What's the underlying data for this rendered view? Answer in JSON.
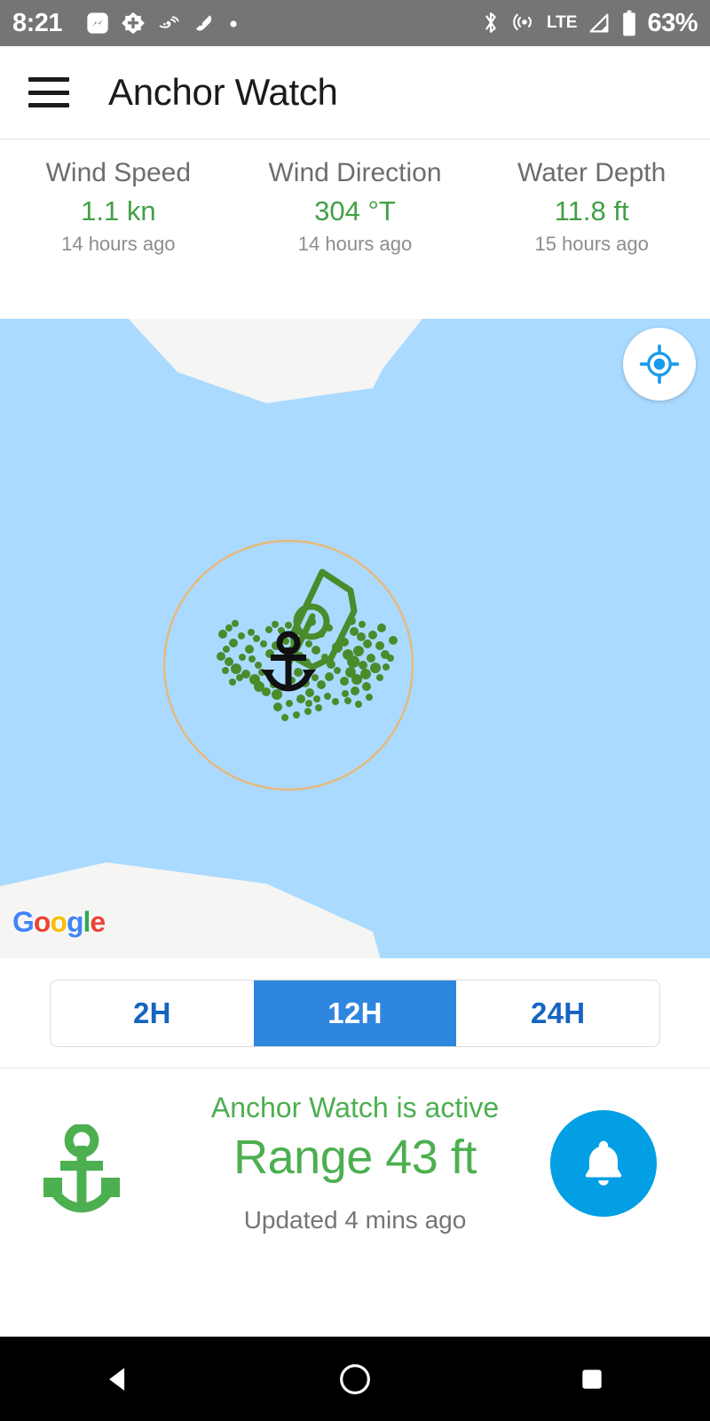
{
  "status_bar": {
    "time": "8:21",
    "battery_percent": "63%",
    "network_type": "LTE",
    "notification_icons": [
      "messenger-icon",
      "plus-badge-icon",
      "bird-icon",
      "shape-icon",
      "dot-icon"
    ],
    "system_icons": [
      "bluetooth-icon",
      "hotspot-icon",
      "signal-icon",
      "battery-icon"
    ]
  },
  "app_bar": {
    "menu_icon": "hamburger-menu-icon",
    "title": "Anchor Watch"
  },
  "stats": [
    {
      "label": "Wind Speed",
      "value": "1.1 kn",
      "time": "14 hours ago"
    },
    {
      "label": "Wind Direction",
      "value": "304 °T",
      "time": "14 hours ago"
    },
    {
      "label": "Water Depth",
      "value": "11.8 ft",
      "time": "15 hours ago"
    }
  ],
  "map": {
    "my_location_icon": "my-location-crosshair-icon",
    "attribution": "Google",
    "attribution_letters": [
      "G",
      "o",
      "o",
      "g",
      "l",
      "e"
    ],
    "anchor_marker_icon": "anchor-marker-icon",
    "vessel_icon": "boat-outline-icon",
    "swing_circle_color": "#E8B87A",
    "track_color": "#4A8B2C",
    "water_color": "#AADAFF",
    "land_color": "#F5F5F3"
  },
  "range_selector": {
    "options": [
      {
        "label": "2H",
        "selected": false
      },
      {
        "label": "12H",
        "selected": true
      },
      {
        "label": "24H",
        "selected": false
      }
    ],
    "selected_color": "#2E86DE",
    "text_color": "#1565C0"
  },
  "bottom_panel": {
    "anchor_icon": "anchor-icon",
    "status_text": "Anchor Watch is active",
    "range_text": "Range 43 ft",
    "updated_text": "Updated 4 mins ago",
    "alarm_icon": "bell-icon",
    "alarm_button_color": "#029FE4",
    "active_color": "#4CAF50"
  },
  "nav_bar": {
    "back_icon": "back-triangle-icon",
    "home_icon": "home-circle-icon",
    "recents_icon": "recents-square-icon"
  }
}
